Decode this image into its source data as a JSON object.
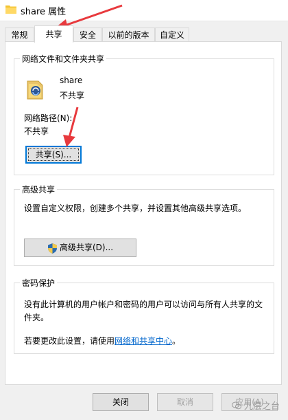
{
  "window": {
    "title": "share 属性"
  },
  "tabs": [
    {
      "label": "常规"
    },
    {
      "label": "共享"
    },
    {
      "label": "安全"
    },
    {
      "label": "以前的版本"
    },
    {
      "label": "自定义"
    }
  ],
  "network_sharing": {
    "group_title": "网络文件和文件夹共享",
    "folder_name": "share",
    "status": "不共享",
    "path_label": "网络路径(N):",
    "path_value": "不共享",
    "share_button": "共享(S)..."
  },
  "advanced_sharing": {
    "group_title": "高级共享",
    "description": "设置自定义权限，创建多个共享，并设置其他高级共享选项。",
    "button": "高级共享(D)..."
  },
  "password_protection": {
    "group_title": "密码保护",
    "description_line1": "没有此计算机的用户帐户和密码的用户可以访问与所有人共享的文",
    "description_line2": "件夹。",
    "change_prefix": "若要更改此设置，请使用",
    "change_link": "网络和共享中心",
    "change_suffix": "。"
  },
  "footer": {
    "close": "关闭",
    "cancel": "取消",
    "apply": "应用(A)"
  },
  "watermark": "九层之台",
  "colors": {
    "accent": "#0078d7",
    "link": "#0066cc",
    "annotation_arrow": "#e8393d"
  }
}
